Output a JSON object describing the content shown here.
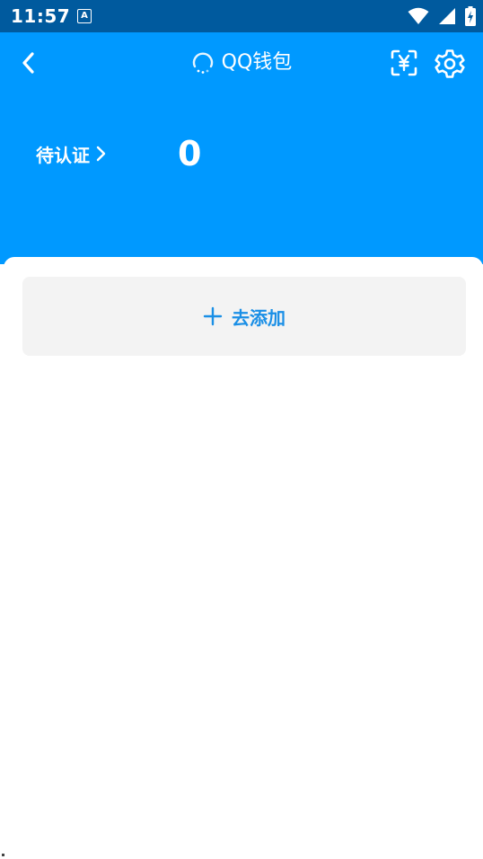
{
  "status_bar": {
    "time": "11:57",
    "notification_letter": "A",
    "icons": [
      "wifi-icon",
      "signal-icon",
      "battery-charging-icon"
    ]
  },
  "header": {
    "title": "QQ钱包",
    "back_icon": "back-arrow-icon",
    "loading_icon": "loading-spinner-icon",
    "scan_icon": "scan-yuan-icon",
    "settings_icon": "gear-icon",
    "background_color": "#0099ff"
  },
  "pending": {
    "label": "待认证",
    "count": "0"
  },
  "add_card": {
    "label": "去添加",
    "icon": "plus-icon",
    "accent_color": "#1a8fe6"
  }
}
